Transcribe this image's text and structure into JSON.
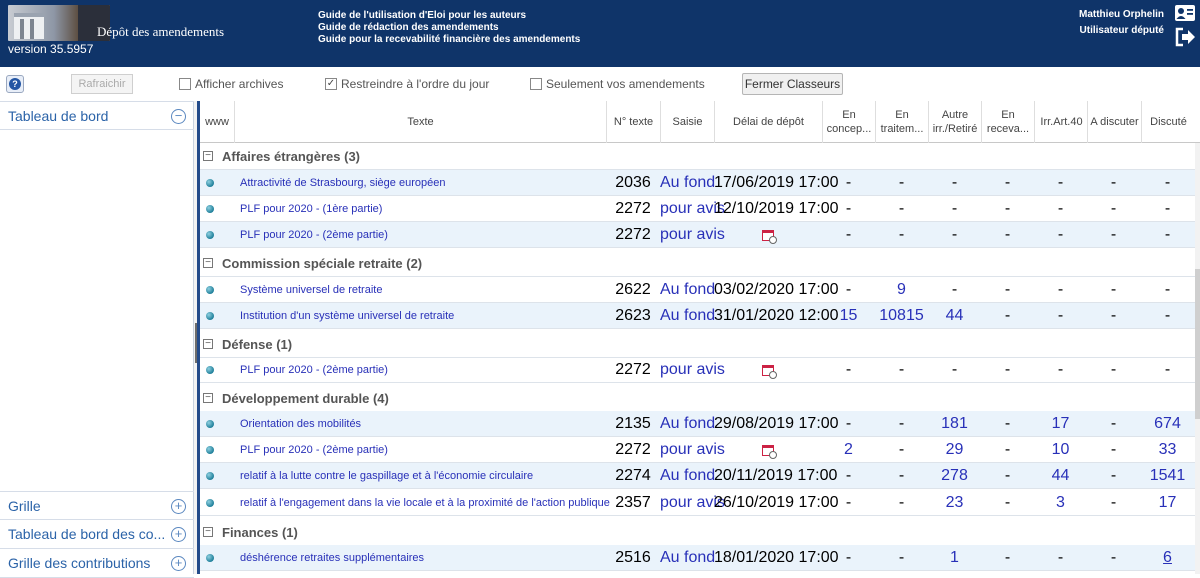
{
  "header": {
    "app_title": "Dépôt des amendements",
    "version": "version 35.5957",
    "guides": [
      "Guide de l'utilisation d'Eloi pour les auteurs",
      "Guide de rédaction des amendements",
      "Guide pour la recevabilité financière des amendements"
    ],
    "user_name": "Matthieu Orphelin",
    "user_role": "Utilisateur député"
  },
  "toolbar": {
    "refresh": "Rafraichir",
    "archives": "Afficher archives",
    "restrict": "Restreindre à l'ordre du jour",
    "only_mine": "Seulement vos amendements",
    "close_folders": "Fermer Classeurs"
  },
  "left_panel": {
    "dashboard": "Tableau de bord",
    "grid": "Grille",
    "dashboard_contrib": "Tableau de bord des co...",
    "grid_contrib": "Grille des contributions"
  },
  "columns": {
    "www": "www",
    "texte": "Texte",
    "num": "N° texte",
    "saisie": "Saisie",
    "delai": "Délai de dépôt",
    "concep_1": "En",
    "concep_2": "concep...",
    "trait_1": "En",
    "trait_2": "traitem...",
    "autre_1": "Autre",
    "autre_2": "irr./Retiré",
    "recev_1": "En",
    "recev_2": "receva...",
    "irr": "Irr.Art.40",
    "discuter": "A discuter",
    "discute": "Discuté"
  },
  "groups": {
    "g1": "Affaires étrangères (3)",
    "g2": "Commission spéciale retraite (2)",
    "g3": "Défense (1)",
    "g4": "Développement durable (4)",
    "g5": "Finances (1)"
  },
  "rows": [
    {
      "texte": "Attractivité de Strasbourg, siège européen",
      "num": "2036",
      "saisie": "Au fond",
      "delai": "17/06/2019 17:00",
      "concep": "-",
      "trait": "-",
      "autre": "-",
      "recev": "-",
      "irr": "-",
      "discuter": "-",
      "discute": "-"
    },
    {
      "texte": "PLF pour 2020 - (1ère partie)",
      "num": "2272",
      "saisie": "pour avis",
      "delai": "12/10/2019 17:00",
      "concep": "-",
      "trait": "-",
      "autre": "-",
      "recev": "-",
      "irr": "-",
      "discuter": "-",
      "discute": "-"
    },
    {
      "texte": "PLF pour 2020 - (2ème partie)",
      "num": "2272",
      "saisie": "pour avis",
      "delai": "",
      "concep": "-",
      "trait": "-",
      "autre": "-",
      "recev": "-",
      "irr": "-",
      "discuter": "-",
      "discute": "-"
    },
    {
      "texte": "Système universel de retraite",
      "num": "2622",
      "saisie": "Au fond",
      "delai": "03/02/2020 17:00",
      "concep": "-",
      "trait": "9",
      "autre": "-",
      "recev": "-",
      "irr": "-",
      "discuter": "-",
      "discute": "-"
    },
    {
      "texte": "Institution d'un système universel de retraite",
      "num": "2623",
      "saisie": "Au fond",
      "delai": "31/01/2020 12:00",
      "concep": "15",
      "trait": "10815",
      "autre": "44",
      "recev": "-",
      "irr": "-",
      "discuter": "-",
      "discute": "-"
    },
    {
      "texte": "PLF pour 2020 - (2ème partie)",
      "num": "2272",
      "saisie": "pour avis",
      "delai": "",
      "concep": "-",
      "trait": "-",
      "autre": "-",
      "recev": "-",
      "irr": "-",
      "discuter": "-",
      "discute": "-"
    },
    {
      "texte": "Orientation des mobilités",
      "num": "2135",
      "saisie": "Au fond",
      "delai": "29/08/2019 17:00",
      "concep": "-",
      "trait": "-",
      "autre": "181",
      "recev": "-",
      "irr": "17",
      "discuter": "-",
      "discute": "674"
    },
    {
      "texte": "PLF pour 2020 - (2ème partie)",
      "num": "2272",
      "saisie": "pour avis",
      "delai": "",
      "concep": "2",
      "trait": "-",
      "autre": "29",
      "recev": "-",
      "irr": "10",
      "discuter": "-",
      "discute": "33"
    },
    {
      "texte": "relatif à la lutte contre le gaspillage et à l'économie circulaire",
      "num": "2274",
      "saisie": "Au fond",
      "delai": "20/11/2019 17:00",
      "concep": "-",
      "trait": "-",
      "autre": "278",
      "recev": "-",
      "irr": "44",
      "discuter": "-",
      "discute": "1541"
    },
    {
      "texte": "relatif à l'engagement dans la vie locale et à la proximité de l'action publique",
      "num": "2357",
      "saisie": "pour avis",
      "delai": "26/10/2019 17:00",
      "concep": "-",
      "trait": "-",
      "autre": "23",
      "recev": "-",
      "irr": "3",
      "discuter": "-",
      "discute": "17"
    },
    {
      "texte": "déshérence retraites supplémentaires",
      "num": "2516",
      "saisie": "Au fond",
      "delai": "18/01/2020 17:00",
      "concep": "-",
      "trait": "-",
      "autre": "1",
      "recev": "-",
      "irr": "-",
      "discuter": "-",
      "discute": "6"
    }
  ]
}
